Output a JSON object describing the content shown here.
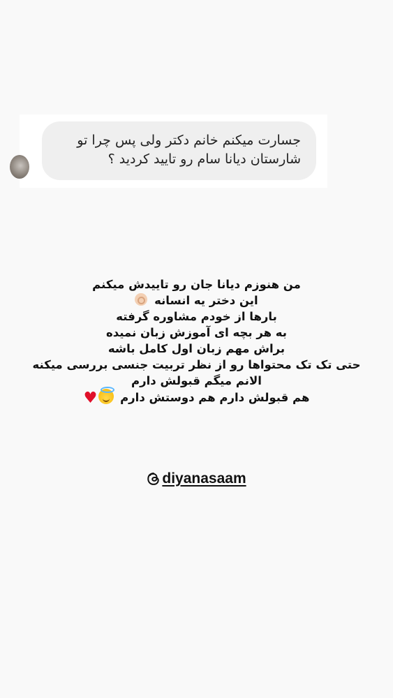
{
  "question_card": {
    "avatar_icon": "profile-avatar",
    "message_line1": "جسارت میکنم خانم دکتر ولی پس چرا تو",
    "message_line2": "شارستان دیانا سام رو تایید کردید ؟"
  },
  "story_text": {
    "lines": [
      "من هنوزم دیانا جان رو تاییدش میکنم",
      "این دختر یه انسانه",
      "بارها از خودم مشاوره گرفته",
      "به هر بچه ای آموزش زبان نمیده",
      "براش مهم زبان اول کامل باشه",
      "حتی تک تک محتواها رو از نظر تربیت جنسی بررسی میکنه",
      "الانم میگم قبولش دارم",
      "هم قبولش دارم هم دوستش دارم"
    ],
    "emojis": [
      "ok-hand-emoji",
      "smiling-face-with-halo-emoji",
      "red-heart-emoji"
    ]
  },
  "mention": {
    "icon": "threads-icon",
    "handle": "diyanasaam"
  }
}
